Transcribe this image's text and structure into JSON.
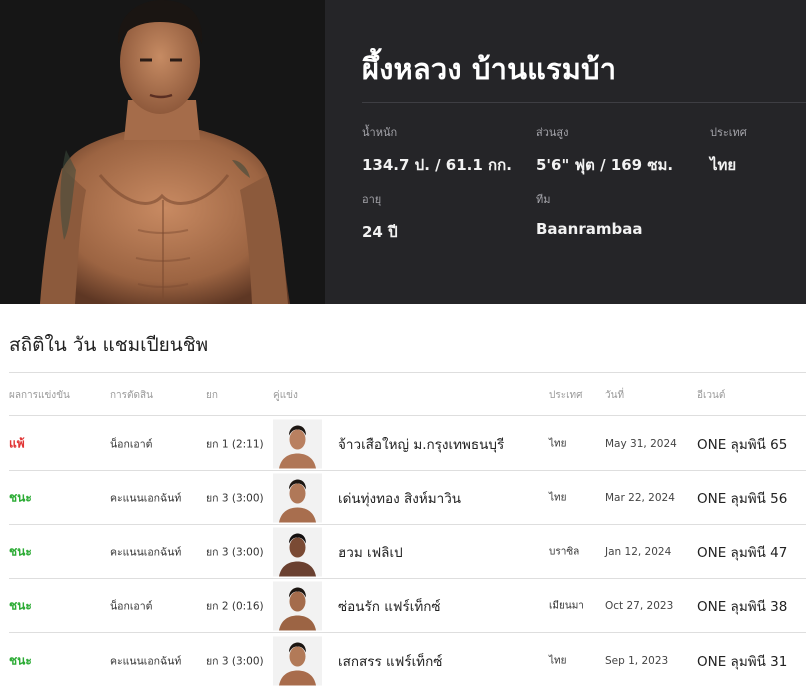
{
  "fighter": {
    "name": "ผึ้งหลวง บ้านแรมบ้า",
    "weight_label": "น้ำหนัก",
    "weight_value": "134.7 ป. / 61.1 กก.",
    "height_label": "ส่วนสูง",
    "height_value": "5'6\" ฟุต / 169 ซม.",
    "country_label": "ประเทศ",
    "country_value": "ไทย",
    "age_label": "อายุ",
    "age_value": "24 ปี",
    "team_label": "ทีม",
    "team_value": "Baanrambaa"
  },
  "stats": {
    "title": "สถิติใน วัน แชมเปียนชิพ",
    "columns": [
      "ผลการแข่งขัน",
      "การตัดสิน",
      "ยก",
      "คู่แข่ง",
      "ประเทศ",
      "วันที่",
      "อีเวนต์"
    ],
    "rows": [
      {
        "result": "แพ้",
        "method": "น็อกเอาต์",
        "round": "ยก 1 (2:11)",
        "opponent": "จ้าวเสือใหญ่ ม.กรุงเทพธนบุรี",
        "country": "ไทย",
        "date": "May 31, 2024",
        "event": "ONE ลุมพินี 65"
      },
      {
        "result": "ชนะ",
        "method": "คะแนนเอกฉันท์",
        "round": "ยก 3 (3:00)",
        "opponent": "เด่นทุ่งทอง สิงห์มาวิน",
        "country": "ไทย",
        "date": "Mar 22, 2024",
        "event": "ONE ลุมพินี 56"
      },
      {
        "result": "ชนะ",
        "method": "คะแนนเอกฉันท์",
        "round": "ยก 3 (3:00)",
        "opponent": "ฮวม เฟลิเป",
        "country": "บราซิล",
        "date": "Jan 12, 2024",
        "event": "ONE ลุมพินี 47"
      },
      {
        "result": "ชนะ",
        "method": "น็อกเอาต์",
        "round": "ยก 2 (0:16)",
        "opponent": "ซ่อนรัก แฟร์เท็กซ์",
        "country": "เมียนมา",
        "date": "Oct 27, 2023",
        "event": "ONE ลุมพินี 38"
      },
      {
        "result": "ชนะ",
        "method": "คะแนนเอกฉันท์",
        "round": "ยก 3 (3:00)",
        "opponent": "เสกสรร แฟร์เท็กซ์",
        "country": "ไทย",
        "date": "Sep 1, 2023",
        "event": "ONE ลุมพินี 31"
      }
    ]
  },
  "colors": {
    "loss": "#e13434",
    "win": "#2bab34",
    "header_bg": "#252528"
  }
}
